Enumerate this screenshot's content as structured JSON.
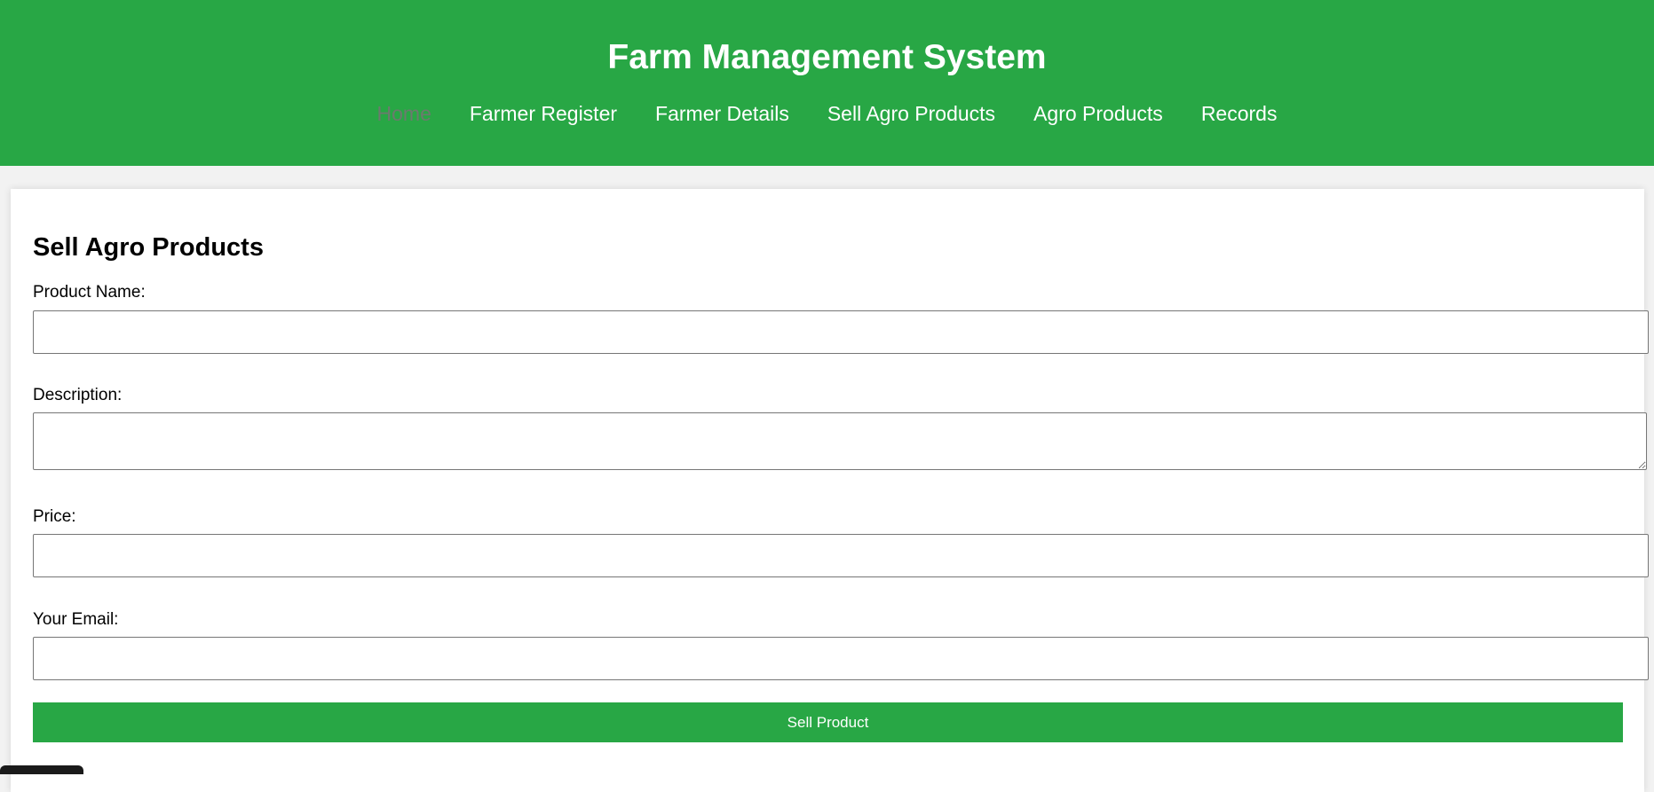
{
  "header": {
    "title": "Farm Management System",
    "nav": [
      {
        "label": "Home",
        "active": true
      },
      {
        "label": "Farmer Register",
        "active": false
      },
      {
        "label": "Farmer Details",
        "active": false
      },
      {
        "label": "Sell Agro Products",
        "active": false
      },
      {
        "label": "Agro Products",
        "active": false
      },
      {
        "label": "Records",
        "active": false
      }
    ]
  },
  "form": {
    "title": "Sell Agro Products",
    "product_name": {
      "label": "Product Name:",
      "value": ""
    },
    "description": {
      "label": "Description:",
      "value": ""
    },
    "price": {
      "label": "Price:",
      "value": ""
    },
    "email": {
      "label": "Your Email:",
      "value": ""
    },
    "submit_label": "Sell Product"
  },
  "colors": {
    "brand_green": "#28a745",
    "nav_active": "#6c7a6e",
    "page_bg": "#f2f2f2"
  }
}
